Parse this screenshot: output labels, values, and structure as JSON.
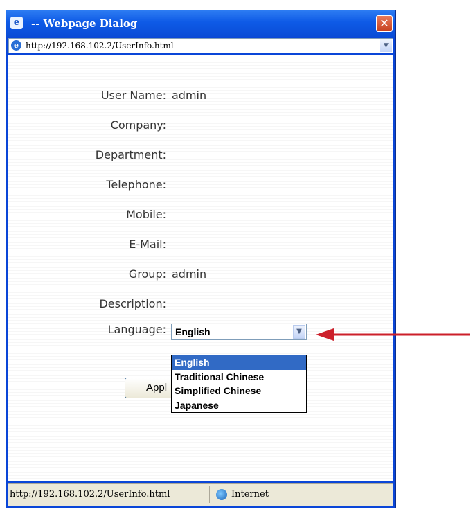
{
  "window": {
    "title": "-- Webpage Dialog",
    "close_glyph": "✕",
    "address": "http://192.168.102.2/UserInfo.html"
  },
  "form": {
    "fields": [
      {
        "label": "User Name:",
        "value": "admin"
      },
      {
        "label": "Company:",
        "value": ""
      },
      {
        "label": "Department:",
        "value": ""
      },
      {
        "label": "Telephone:",
        "value": ""
      },
      {
        "label": "Mobile:",
        "value": ""
      },
      {
        "label": "E-Mail:",
        "value": ""
      },
      {
        "label": "Group:",
        "value": "admin"
      },
      {
        "label": "Description:",
        "value": ""
      }
    ],
    "language": {
      "label": "Language:",
      "selected": "English",
      "options": [
        "English",
        "Traditional Chinese",
        "Simplified Chinese",
        "Japanese"
      ]
    },
    "apply_label": "Appl"
  },
  "statusbar": {
    "url": "http://192.168.102.2/UserInfo.html",
    "zone": "Internet"
  },
  "colors": {
    "title_bar": "#0a4cd6",
    "selection": "#316ac5",
    "arrow": "#cc1f2a"
  },
  "icons": [
    "ie-icon",
    "close-icon",
    "chevron-down-icon",
    "globe-icon",
    "arrow-left-icon"
  ]
}
